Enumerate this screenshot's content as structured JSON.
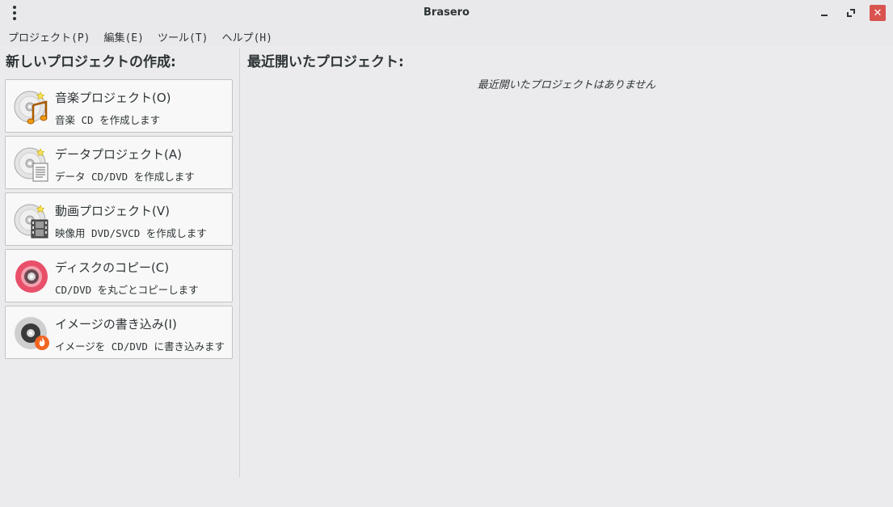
{
  "window": {
    "title": "Brasero"
  },
  "menu": [
    "プロジェクト(P)",
    "編集(E)",
    "ツール(T)",
    "ヘルプ(H)"
  ],
  "left": {
    "heading": "新しいプロジェクトの作成:",
    "projects": [
      {
        "title": "音楽プロジェクト(O)",
        "desc": "音楽 CD を作成します",
        "icon": "audio-cd-icon"
      },
      {
        "title": "データプロジェクト(A)",
        "desc": "データ CD/DVD を作成します",
        "icon": "data-disc-icon"
      },
      {
        "title": "動画プロジェクト(V)",
        "desc": "映像用 DVD/SVCD を作成します",
        "icon": "video-disc-icon"
      },
      {
        "title": "ディスクのコピー(C)",
        "desc": "CD/DVD を丸ごとコピーします",
        "icon": "disc-copy-icon"
      },
      {
        "title": "イメージの書き込み(I)",
        "desc": "イメージを CD/DVD に書き込みます",
        "icon": "burn-image-icon"
      }
    ]
  },
  "right": {
    "heading": "最近開いたプロジェクト:",
    "empty_message": "最近開いたプロジェクトはありません"
  }
}
